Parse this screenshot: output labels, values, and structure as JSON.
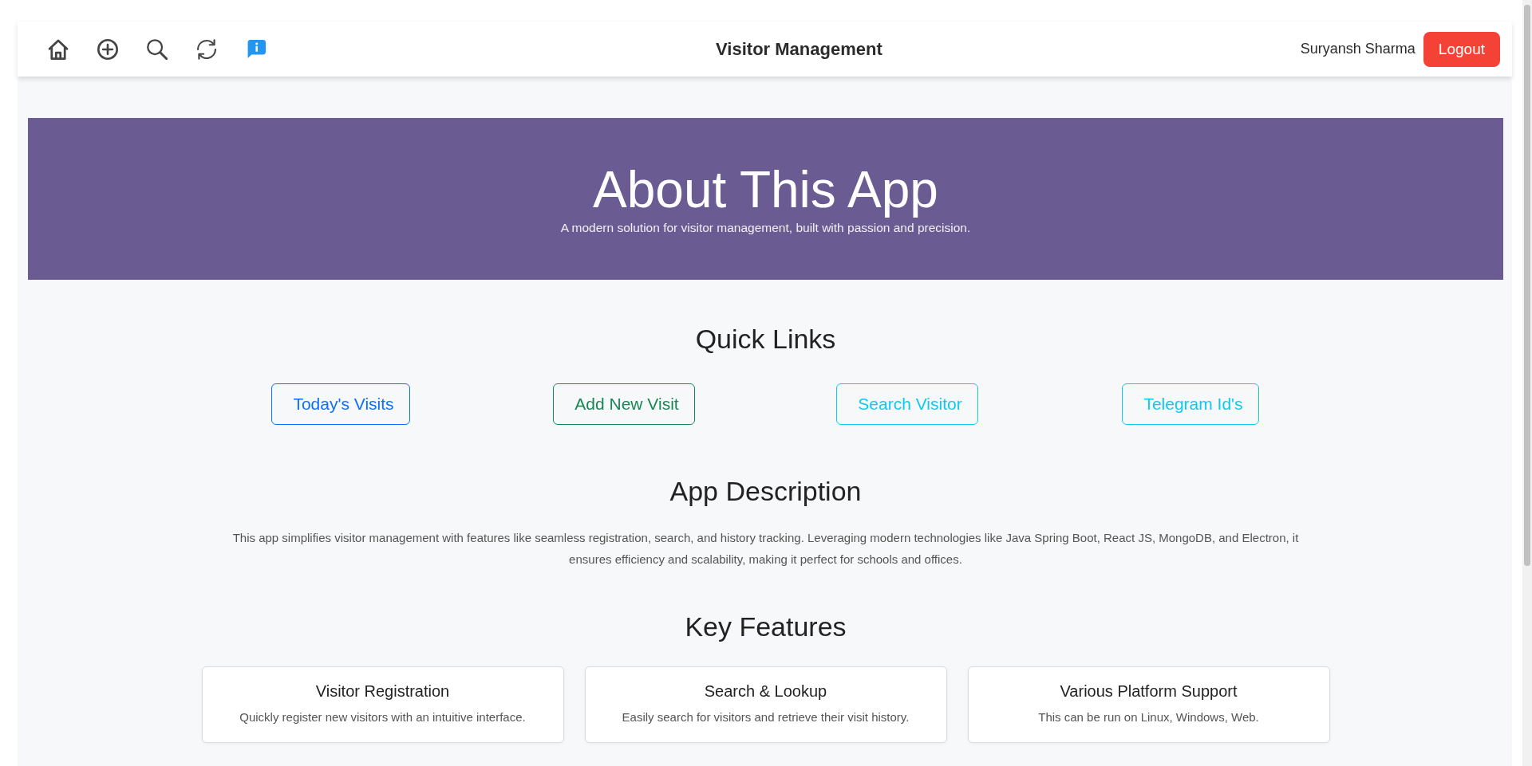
{
  "navbar": {
    "icons": [
      {
        "kind": "home",
        "selected": false
      },
      {
        "kind": "add",
        "selected": false
      },
      {
        "kind": "search",
        "selected": false
      },
      {
        "kind": "refresh",
        "selected": false
      },
      {
        "kind": "info",
        "selected": true
      }
    ],
    "title": "Visitor Management",
    "user": "Suryansh Sharma",
    "logout_button": "Logout"
  },
  "hero": {
    "title": "About This App",
    "subtitle": "A modern solution for visitor management, built with passion and precision."
  },
  "quick_links": {
    "heading": "Quick Links",
    "items": [
      {
        "label": "Today's Visits",
        "color": "#0d6efd"
      },
      {
        "label": "Add New Visit",
        "color": "#198754"
      },
      {
        "label": "Search Visitor",
        "color": "#0dcaf0"
      },
      {
        "label": "Telegram Id's",
        "color": "#0dcaf0"
      }
    ]
  },
  "description": {
    "heading": "App Description",
    "text": "This app simplifies visitor management with features like seamless registration, search, and history tracking. Leveraging modern technologies like Java Spring Boot, React JS, MongoDB, and Electron, it ensures efficiency and scalability, making it perfect for schools and offices."
  },
  "features": {
    "heading": "Key Features",
    "cards": [
      {
        "title": "Visitor Registration",
        "text": "Quickly register new visitors with an intuitive interface."
      },
      {
        "title": "Search & Lookup",
        "text": "Easily search for visitors and retrieve their visit history."
      },
      {
        "title": "Various Platform Support",
        "text": "This can be run on Linux, Windows, Web."
      }
    ]
  }
}
